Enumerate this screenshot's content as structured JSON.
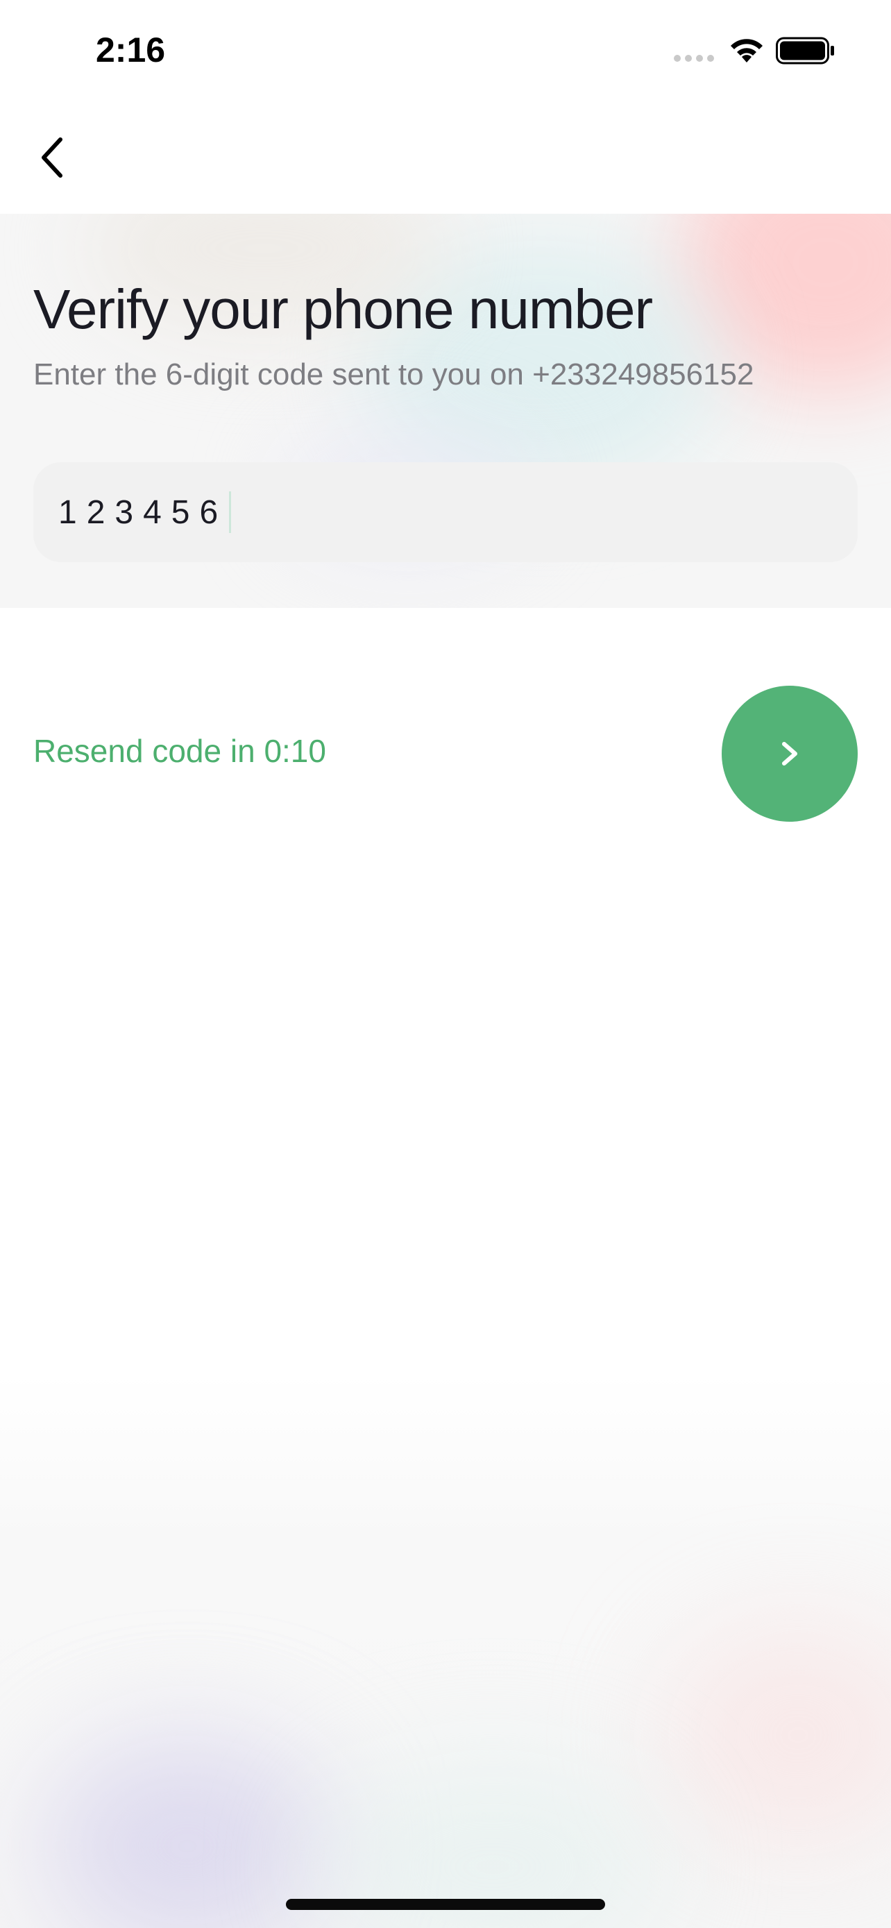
{
  "status_bar": {
    "time": "2:16",
    "icons": [
      "signal-dots-icon",
      "wifi-icon",
      "battery-icon"
    ]
  },
  "nav": {
    "back_icon": "chevron-left-icon"
  },
  "header": {
    "title": "Verify your phone number",
    "subtitle": "Enter the 6-digit code sent to you on +233249856152"
  },
  "code_input": {
    "value": "123456"
  },
  "resend": {
    "label": "Resend code in 0:10"
  },
  "next_button": {
    "icon": "chevron-right-icon"
  },
  "colors": {
    "accent": "#53b377",
    "resend_text": "#4caf6e",
    "title_text": "#1b1b24",
    "subtitle_text": "#7d7d82",
    "input_bg": "#f1f1f1"
  }
}
